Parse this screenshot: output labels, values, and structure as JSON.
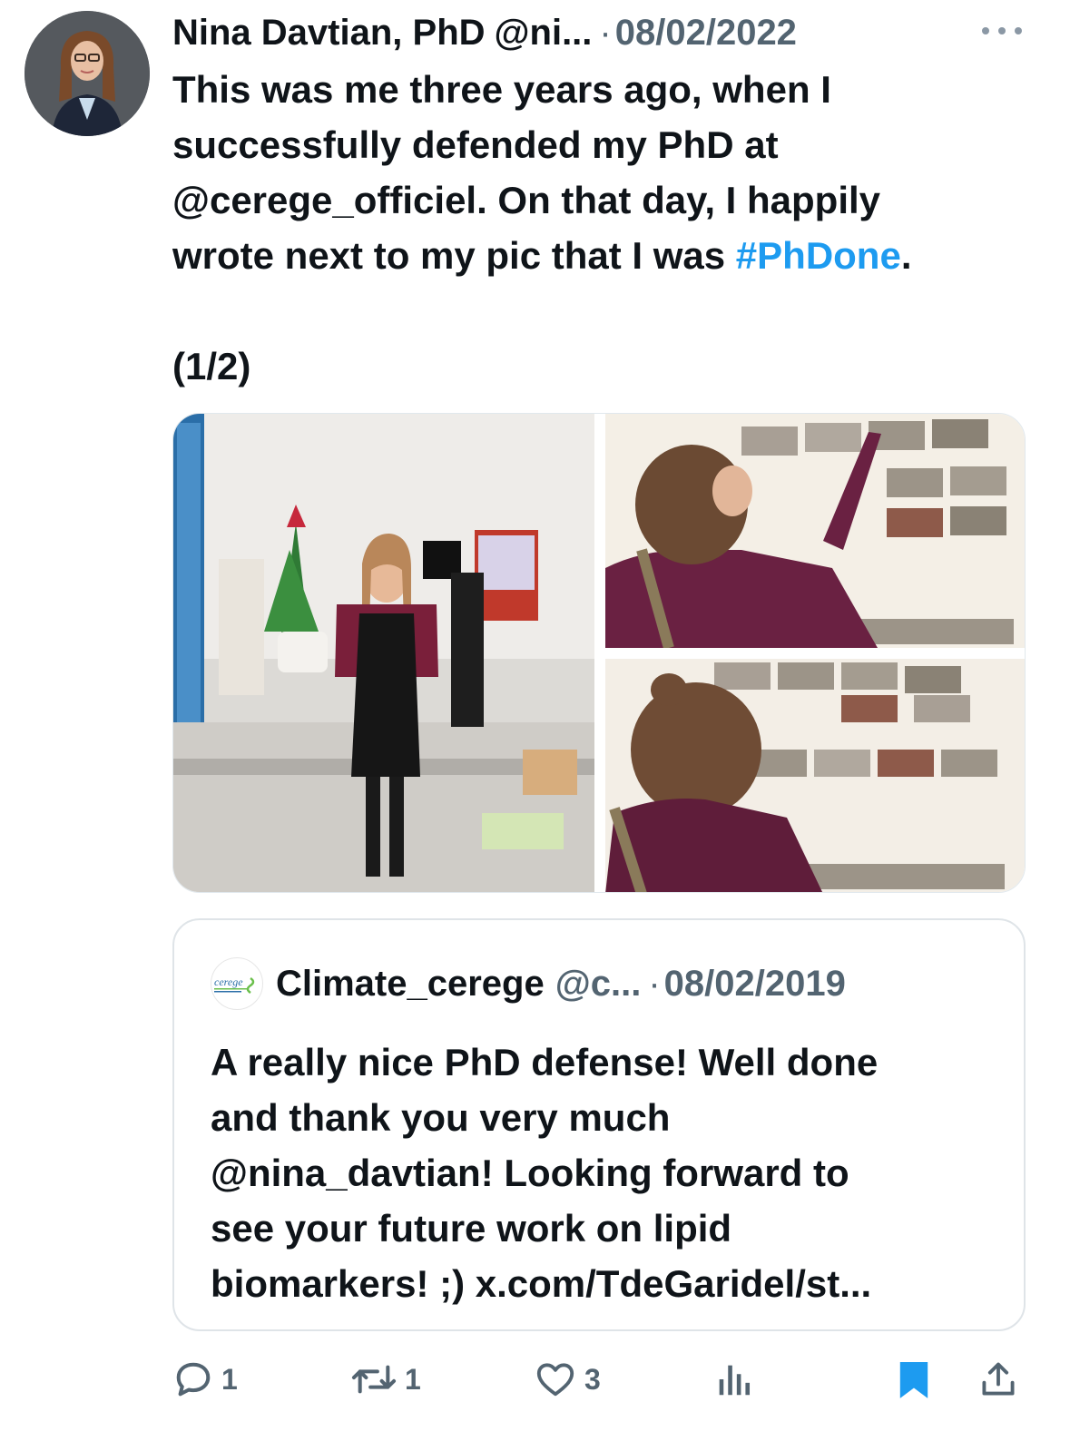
{
  "tweet": {
    "author_name": "Nina Davtian, PhD",
    "author_handle": "@ni...",
    "separator": "·",
    "date": "08/02/2022",
    "text_lines": [
      "This was me three years ago, when I",
      "successfully defended my PhD at",
      "@cerege_officiel. On that day, I happily",
      "wrote next to my pic that I was "
    ],
    "hashtag": "#PhDone",
    "after_hashtag": ".",
    "thread_marker": "(1/2)"
  },
  "media": {
    "photos": [
      {
        "icon": "photo-woman-holding-plant"
      },
      {
        "icon": "photo-woman-writing-on-board"
      },
      {
        "icon": "photo-woman-at-photo-wall"
      }
    ]
  },
  "quote": {
    "avatar_text": "cerege",
    "author_name": "Climate_cerege",
    "author_handle": "@c...",
    "separator": "·",
    "date": "08/02/2019",
    "text_lines": [
      "A really nice PhD defense! Well done",
      "and thank you very much",
      "@nina_davtian! Looking forward to",
      "see your future work on lipid",
      "biomarkers! ;) x.com/TdeGaridel/st..."
    ]
  },
  "actions": {
    "replies": "1",
    "reposts": "1",
    "likes": "3",
    "bookmarked": true,
    "accent_color": "#1d9bf0",
    "muted_color": "#536471"
  }
}
